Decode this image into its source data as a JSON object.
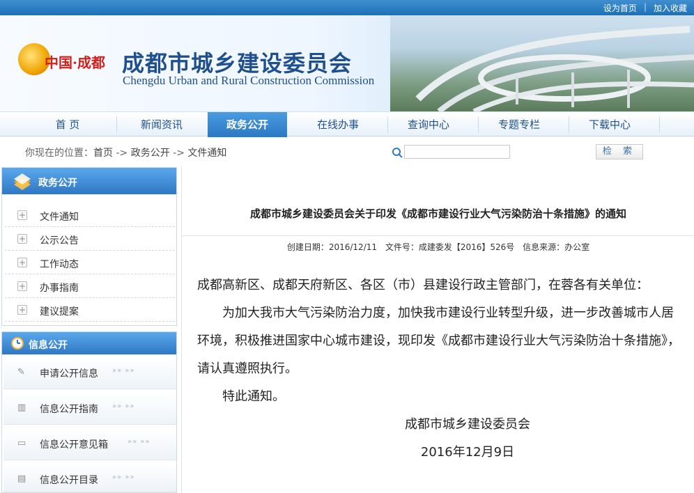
{
  "toplinks": {
    "home": "设为首页",
    "favorite": "加入收藏"
  },
  "banner": {
    "emblem_text": "中国·成都",
    "title_cn": "成都市城乡建设委员会",
    "title_en": "Chengdu Urban and Rural Construction Commission"
  },
  "nav": {
    "items": [
      {
        "label": "首  页"
      },
      {
        "label": "新闻资讯"
      },
      {
        "label": "政务公开",
        "active": true
      },
      {
        "label": "在线办事"
      },
      {
        "label": "查询中心"
      },
      {
        "label": "专题专栏"
      },
      {
        "label": "下载中心"
      }
    ]
  },
  "breadcrumb": {
    "prefix": "你现在的位置：",
    "items": [
      "首页",
      "政务公开",
      "文件通知"
    ],
    "sep": "->"
  },
  "search": {
    "placeholder": "",
    "button": "检 索"
  },
  "sidebar": {
    "panel1": {
      "title": "政务公开",
      "items": [
        "文件通知",
        "公示公告",
        "工作动态",
        "办事指南",
        "建议提案"
      ]
    },
    "panel2": {
      "title": "信息公开",
      "items": [
        {
          "label": "申请公开信息",
          "icon": "edit-icon"
        },
        {
          "label": "信息公开指南",
          "icon": "bar-chart-icon"
        },
        {
          "label": "信息公开意见箱",
          "icon": "message-icon"
        },
        {
          "label": "信息公开目录",
          "icon": "document-icon"
        }
      ]
    }
  },
  "article": {
    "title": "成都市城乡建设委员会关于印发《成都市建设行业大气污染防治十条措施》的通知",
    "meta": {
      "created": "创建日期：2016/12/11",
      "doc_no": "文件号：成建委发【2016】526号",
      "source": "信息来源：办公室"
    },
    "salutation": "成都高新区、成都天府新区、各区（市）县建设行政主管部门，在蓉各有关单位：",
    "para1": "为加大我市大气污染防治力度，加快我市建设行业转型升级，进一步改善城市人居环境，积极推进国家中心城市建设，现印发《成都市建设行业大气污染防治十条措施》，请认真遵照执行。",
    "para2": "特此通知。",
    "signature": "成都市城乡建设委员会",
    "date": "2016年12月9日"
  },
  "colors": {
    "accent": "#2f78c4",
    "title": "#1e4f8f",
    "emblem_red": "#d2211a"
  }
}
